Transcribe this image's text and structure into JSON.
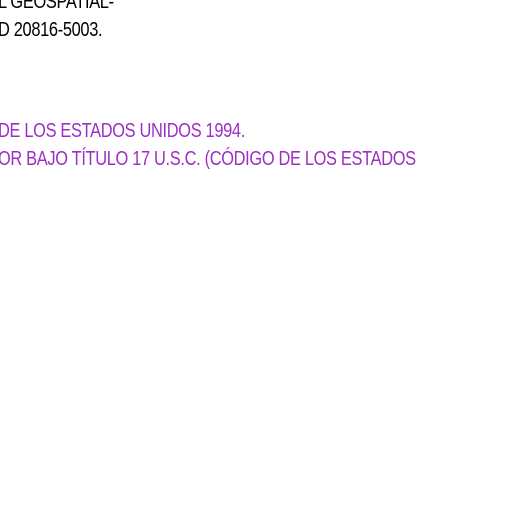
{
  "text_block_black": {
    "line1": "L GEOSPATIAL-",
    "line2": "D 20816-5003."
  },
  "text_block_purple": {
    "line1": "DE LOS ESTADOS UNIDOS 1994.",
    "line2": "OR BAJO TÍTULO 17 U.S.C. (CÓDIGO DE LOS ESTADOS"
  },
  "colors": {
    "black_text": "#000000",
    "purple_text": "#9b2fc4",
    "background": "#ffffff"
  }
}
